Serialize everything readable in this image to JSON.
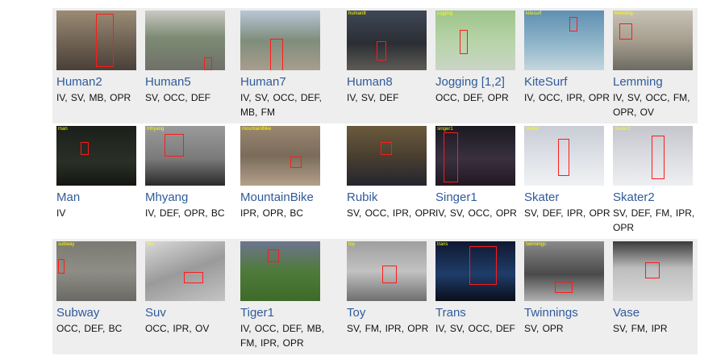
{
  "rows": [
    [
      {
        "name": "Human2",
        "attributes": "IV, SV, MB, OPR",
        "tag": "",
        "bg": "linear-gradient(180deg,#9b8b76 0%,#6e6152 55%,#4a4038 100%)"
      },
      {
        "name": "Human5",
        "attributes": "SV, OCC, DEF",
        "tag": "",
        "bg": "linear-gradient(180deg,#c9c9c4 0%,#7d8b74 45%,#6f7068 100%)"
      },
      {
        "name": "Human7",
        "attributes": "IV, SV, OCC, DEF, MB, FM",
        "tag": "",
        "bg": "linear-gradient(180deg,#b8c7d6 0%,#7f8d7c 50%,#a89d8d 100%)"
      },
      {
        "name": "Human8",
        "attributes": "IV, SV, DEF",
        "tag": "human8",
        "bg": "linear-gradient(180deg,#3f4756 0%,#2b2e34 55%,#5e5b55 100%)"
      },
      {
        "name": "Jogging [1,2]",
        "attributes": "OCC, DEF, OPR",
        "tag": "jogging",
        "bg": "linear-gradient(180deg,#9ec48a 0%,#b7d3a7 50%,#c9d5c6 100%)"
      },
      {
        "name": "KiteSurf",
        "attributes": "IV, OCC, IPR, OPR",
        "tag": "kitesurf",
        "bg": "linear-gradient(180deg,#5f8fb1 0%,#8fb5c9 55%,#c4d6dd 100%)"
      },
      {
        "name": "Lemming",
        "attributes": "IV, SV, OCC, FM, OPR, OV",
        "tag": "lemming",
        "bg": "linear-gradient(180deg,#c7c1b6 0%,#a89f90 50%,#6d6a63 100%)"
      }
    ],
    [
      {
        "name": "Man",
        "attributes": "IV",
        "tag": "man",
        "bg": "linear-gradient(180deg,#1b1f1a 0%,#2a3026 60%,#141612 100%)"
      },
      {
        "name": "Mhyang",
        "attributes": "IV, DEF, OPR, BC",
        "tag": "mhyang",
        "bg": "linear-gradient(180deg,#9a9a9a 0%,#7a7a7a 55%,#2a2a2a 100%)"
      },
      {
        "name": "MountainBike",
        "attributes": "IPR, OPR, BC",
        "tag": "mountainBike",
        "bg": "linear-gradient(180deg,#9a8770 0%,#7a6b5a 50%,#b3a08a 100%)"
      },
      {
        "name": "Rubik",
        "attributes": "SV, OCC, IPR, OPR",
        "tag": "",
        "bg": "linear-gradient(180deg,#6b5a3c 0%,#4a3f30 50%,#23252e 100%)"
      },
      {
        "name": "Singer1",
        "attributes": "IV, SV, OCC, OPR",
        "tag": "singer1",
        "bg": "linear-gradient(180deg,#1a1a22 0%,#3a3040 55%,#201822 100%)"
      },
      {
        "name": "Skater",
        "attributes": "SV, DEF, IPR, OPR",
        "tag": "skater",
        "bg": "linear-gradient(180deg,#c8ccd4 0%,#dfe2e8 55%,#f0f1f4 100%)"
      },
      {
        "name": "Skater2",
        "attributes": "SV, DEF, FM, IPR, OPR",
        "tag": "skater2",
        "bg": "linear-gradient(180deg,#c4c6cc 0%,#dcdee2 55%,#eeeff1 100%)"
      }
    ],
    [
      {
        "name": "Subway",
        "attributes": "OCC, DEF, BC",
        "tag": "subway",
        "bg": "linear-gradient(180deg,#7b7a72 0%,#8e8d86 50%,#6a6963 100%)"
      },
      {
        "name": "Suv",
        "attributes": "OCC, IPR, OV",
        "tag": "suv",
        "bg": "linear-gradient(160deg,#d9d9d9 0%,#9a9a9a 50%,#c4c4c4 100%)"
      },
      {
        "name": "Tiger1",
        "attributes": "IV, OCC, DEF, MB, FM, IPR, OPR",
        "tag": "",
        "bg": "linear-gradient(180deg,#6d7590 0%,#4f7a3a 50%,#3d6a2a 100%)"
      },
      {
        "name": "Toy",
        "attributes": "SV, FM, IPR, OPR",
        "tag": "toy",
        "bg": "linear-gradient(180deg,#9f9f9f 0%,#c2c2c2 50%,#6f6f6f 100%)"
      },
      {
        "name": "Trans",
        "attributes": "IV, SV, OCC, DEF",
        "tag": "trans",
        "bg": "linear-gradient(180deg,#101830 0%,#1f3d6a 55%,#0a0e1a 100%)"
      },
      {
        "name": "Twinnings",
        "attributes": "SV, OPR",
        "tag": "twinnings",
        "bg": "linear-gradient(180deg,#8a8a8a 0%,#4a4a4a 55%,#b0b0b0 100%)"
      },
      {
        "name": "Vase",
        "attributes": "SV, FM, IPR",
        "tag": "",
        "bg": "linear-gradient(180deg,#3a3a3a 0%,#bdbdbd 45%,#d9d9d9 100%)"
      }
    ]
  ]
}
